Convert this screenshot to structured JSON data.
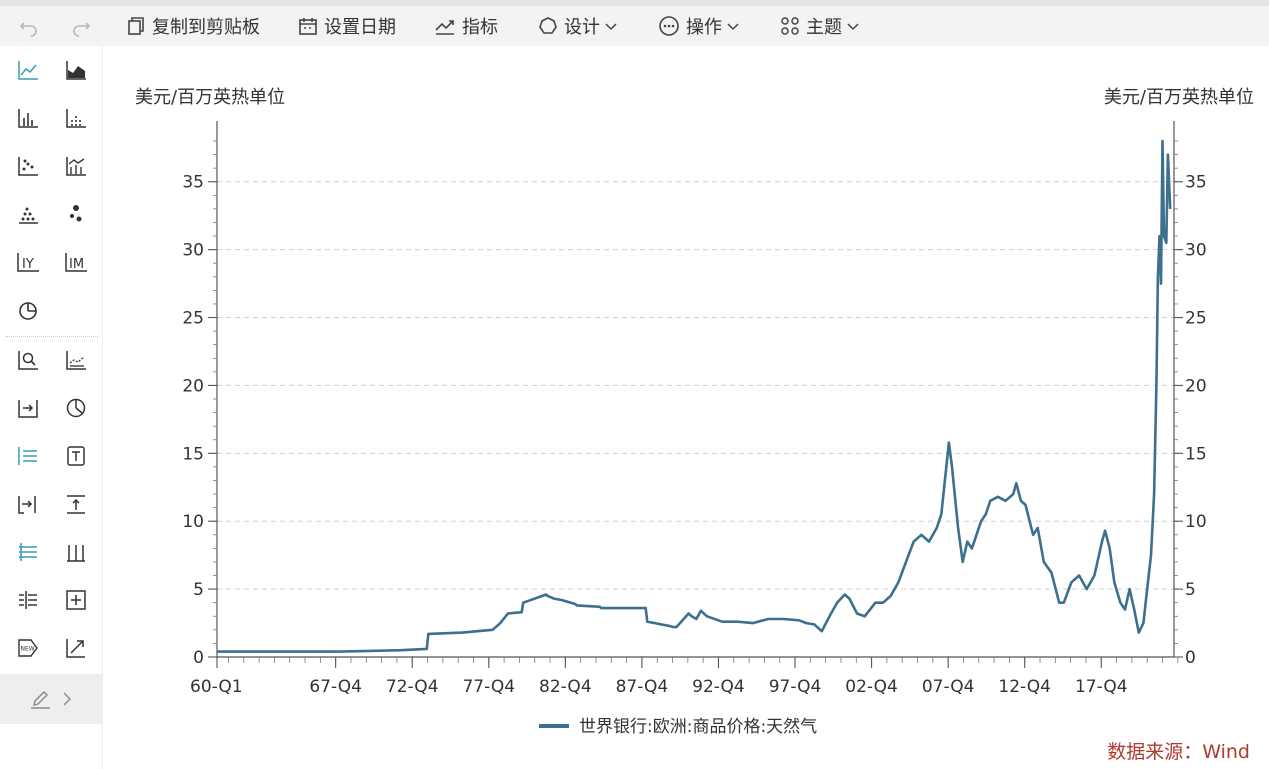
{
  "toolbar": {
    "copy_label": "复制到剪贴板",
    "date_label": "设置日期",
    "indicator_label": "指标",
    "design_label": "设计",
    "operate_label": "操作",
    "theme_label": "主题"
  },
  "sidebar": {
    "icons": [
      "line-chart-icon",
      "area-chart-icon",
      "bar-chart-icon",
      "dot-bar-chart-icon",
      "scatter-chart-icon",
      "combo-chart-icon",
      "dot-matrix-icon",
      "bubble-chart-icon",
      "yearly-chart-icon",
      "monthly-chart-icon",
      "pie-chart-icon",
      "zoom-chart-icon",
      "range-chart-icon",
      "export-icon",
      "pie-select-icon",
      "list-lines-icon",
      "text-box-icon",
      "import-icon",
      "upload-icon",
      "list-align-icon",
      "columns-icon",
      "indent-icon",
      "add-box-icon",
      "new-badge-icon",
      "trend-arrow-icon"
    ]
  },
  "chart_data": {
    "type": "line",
    "left_unit": "美元/百万英热单位",
    "right_unit": "美元/百万英热单位",
    "ylim": [
      0,
      38
    ],
    "yticks": [
      0,
      5,
      10,
      15,
      20,
      25,
      30,
      35
    ],
    "xlim": [
      1960.0,
      2022.5
    ],
    "xtick_labels": [
      {
        "label": "60-Q1",
        "x": 1960.0
      },
      {
        "label": "67-Q4",
        "x": 1967.75
      },
      {
        "label": "72-Q4",
        "x": 1972.75
      },
      {
        "label": "77-Q4",
        "x": 1977.75
      },
      {
        "label": "82-Q4",
        "x": 1982.75
      },
      {
        "label": "87-Q4",
        "x": 1987.75
      },
      {
        "label": "92-Q4",
        "x": 1992.75
      },
      {
        "label": "97-Q4",
        "x": 1997.75
      },
      {
        "label": "02-Q4",
        "x": 2002.75
      },
      {
        "label": "07-Q4",
        "x": 2007.75
      },
      {
        "label": "12-Q4",
        "x": 2012.75
      },
      {
        "label": "17-Q4",
        "x": 2017.75
      }
    ],
    "grid": true,
    "legend_position": "bottom",
    "series": [
      {
        "name": "世界银行:欧洲:商品价格:天然气",
        "color": "#3d6f8e",
        "x": [
          1960,
          1965,
          1968,
          1970,
          1972,
          1973.7,
          1973.8,
          1976,
          1976.5,
          1977,
          1978,
          1978.5,
          1979,
          1979.9,
          1980,
          1981.5,
          1981.6,
          1982,
          1982.5,
          1983.4,
          1983.5,
          1985,
          1985.1,
          1988,
          1988.1,
          1988.6,
          1989,
          1989.5,
          1989.8,
          1990,
          1990.8,
          1991,
          1991.3,
          1991.6,
          1992,
          1993,
          1994,
          1995,
          1996,
          1997,
          1998,
          1998.5,
          1999,
          1999.5,
          2000,
          2000.5,
          2001,
          2001.3,
          2001.8,
          2002.3,
          2003,
          2003.5,
          2004,
          2004.5,
          2005,
          2005.5,
          2006,
          2006.5,
          2007,
          2007.3,
          2007.8,
          2008,
          2008.4,
          2008.7,
          2009.0,
          2009.3,
          2009.6,
          2009.9,
          2010.2,
          2010.5,
          2011,
          2011.5,
          2012,
          2012.2,
          2012.5,
          2012.8,
          2013.3,
          2013.6,
          2014,
          2014.5,
          2015,
          2015.3,
          2015.8,
          2016.3,
          2016.8,
          2017.3,
          2017.8,
          2018.0,
          2018.3,
          2018.6,
          2019,
          2019.3,
          2019.6,
          2019.9,
          2020.2,
          2020.5,
          2020.7,
          2021.0,
          2021.2,
          2021.35,
          2021.45,
          2021.55,
          2021.65,
          2021.75,
          2021.85,
          2022.0,
          2022.1,
          2022.25
        ],
        "values": [
          0.4,
          0.4,
          0.4,
          0.45,
          0.5,
          0.6,
          1.7,
          1.8,
          1.85,
          1.9,
          2.0,
          2.5,
          3.2,
          3.3,
          4.0,
          4.6,
          4.5,
          4.3,
          4.2,
          3.9,
          3.8,
          3.7,
          3.6,
          3.6,
          2.6,
          2.5,
          2.4,
          2.3,
          2.2,
          2.2,
          3.2,
          3.0,
          2.8,
          3.4,
          3.0,
          2.6,
          2.6,
          2.5,
          2.8,
          2.8,
          2.7,
          2.5,
          2.4,
          1.9,
          3.0,
          4.0,
          4.6,
          4.3,
          3.2,
          3.0,
          4.0,
          4.0,
          4.5,
          5.5,
          7.0,
          8.5,
          9.0,
          8.5,
          9.5,
          10.5,
          15.8,
          14.0,
          9.5,
          7.0,
          8.5,
          8.0,
          9.0,
          10.0,
          10.5,
          11.5,
          11.8,
          11.5,
          12.0,
          12.8,
          11.5,
          11.2,
          9.0,
          9.5,
          7.0,
          6.2,
          4.0,
          4.0,
          5.5,
          6.0,
          5.0,
          6.0,
          8.5,
          9.3,
          8.0,
          5.5,
          4.0,
          3.5,
          5.0,
          3.5,
          1.8,
          2.5,
          4.5,
          7.5,
          12.0,
          20.0,
          28.0,
          31.0,
          27.5,
          38.0,
          31.0,
          30.5,
          37.0,
          33.0
        ]
      }
    ]
  },
  "source": "数据来源：Wind"
}
